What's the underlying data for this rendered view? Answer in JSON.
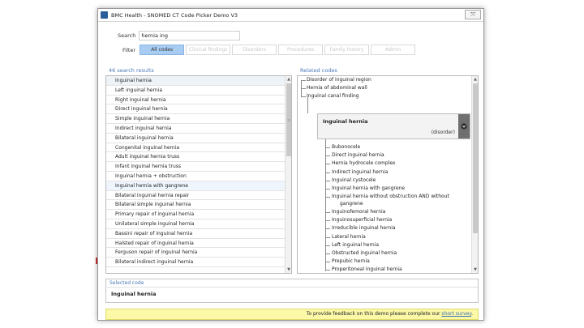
{
  "window": {
    "title": "BMC Health - SNOMED CT Code Picker Demo V3",
    "close_glyph": "⤧"
  },
  "search": {
    "label": "Search",
    "value": "hernia ing"
  },
  "filter": {
    "label": "Filter",
    "buttons": [
      {
        "label": "All codes",
        "active": true
      },
      {
        "label": "Clinical findings",
        "active": false
      },
      {
        "label": "Disorders",
        "active": false
      },
      {
        "label": "Procedures",
        "active": false
      },
      {
        "label": "Family history",
        "active": false
      },
      {
        "label": "Admin",
        "active": false
      }
    ]
  },
  "results": {
    "header": "46 search results",
    "items": [
      "Inguinal hernia",
      "Left inguinal hernia",
      "Right inguinal hernia",
      "Direct inguinal hernia",
      "Simple inguinal hernia",
      "Indirect inguinal hernia",
      "Bilateral inguinal hernia",
      "Congenital inguinal hernia",
      "Adult inguinal hernia truss",
      "Infant inguinal hernia truss",
      "Inguinal hernia + obstruction",
      "Inguinal hernia with gangrene",
      "Bilateral inguinal hernia repair",
      "Bilateral simple inguinal hernia",
      "Primary repair of inguinal hernia",
      "Unilateral simple inguinal hernia",
      "Bassini repair of inguinal hernia",
      "Halsted repair of inguinal hernia",
      "Ferguson repair of inguinal hernia",
      "Bilateral indirect inguinal hernia"
    ]
  },
  "related": {
    "header": "Related codes",
    "parents": [
      "Disorder of inguinal region",
      "Hernia of abdominal wall",
      "Inguinal canal finding"
    ],
    "focus": {
      "title": "Inguinal hernia",
      "tag": "(disorder)"
    },
    "children": [
      "Bubonocele",
      "Direct inguinal hernia",
      "Hernia hydrocele complex",
      "Indirect inguinal hernia",
      "Inguinal cystocele",
      "Inguinal hernia with gangrene",
      "Inguinal hernia without obstruction AND without",
      "gangrene",
      "Inguinofemoral hernia",
      "Inguinosuperficial hernia",
      "Irreducible inguinal hernia",
      "Lateral hernia",
      "Left inguinal hernia",
      "Obstructed inguinal hernia",
      "Prepubic hernia",
      "Properitoneal inguinal hernia"
    ]
  },
  "selected": {
    "header": "Selected code",
    "value": "Inguinal hernia"
  },
  "feedback": {
    "text": "To provide feedback on this demo please complete our",
    "link": "short survey",
    "end": "."
  },
  "colors": {
    "accent": "#4a78b8",
    "active_filter": "#a9cdf2",
    "feedback_bg": "#fbf8a8"
  }
}
